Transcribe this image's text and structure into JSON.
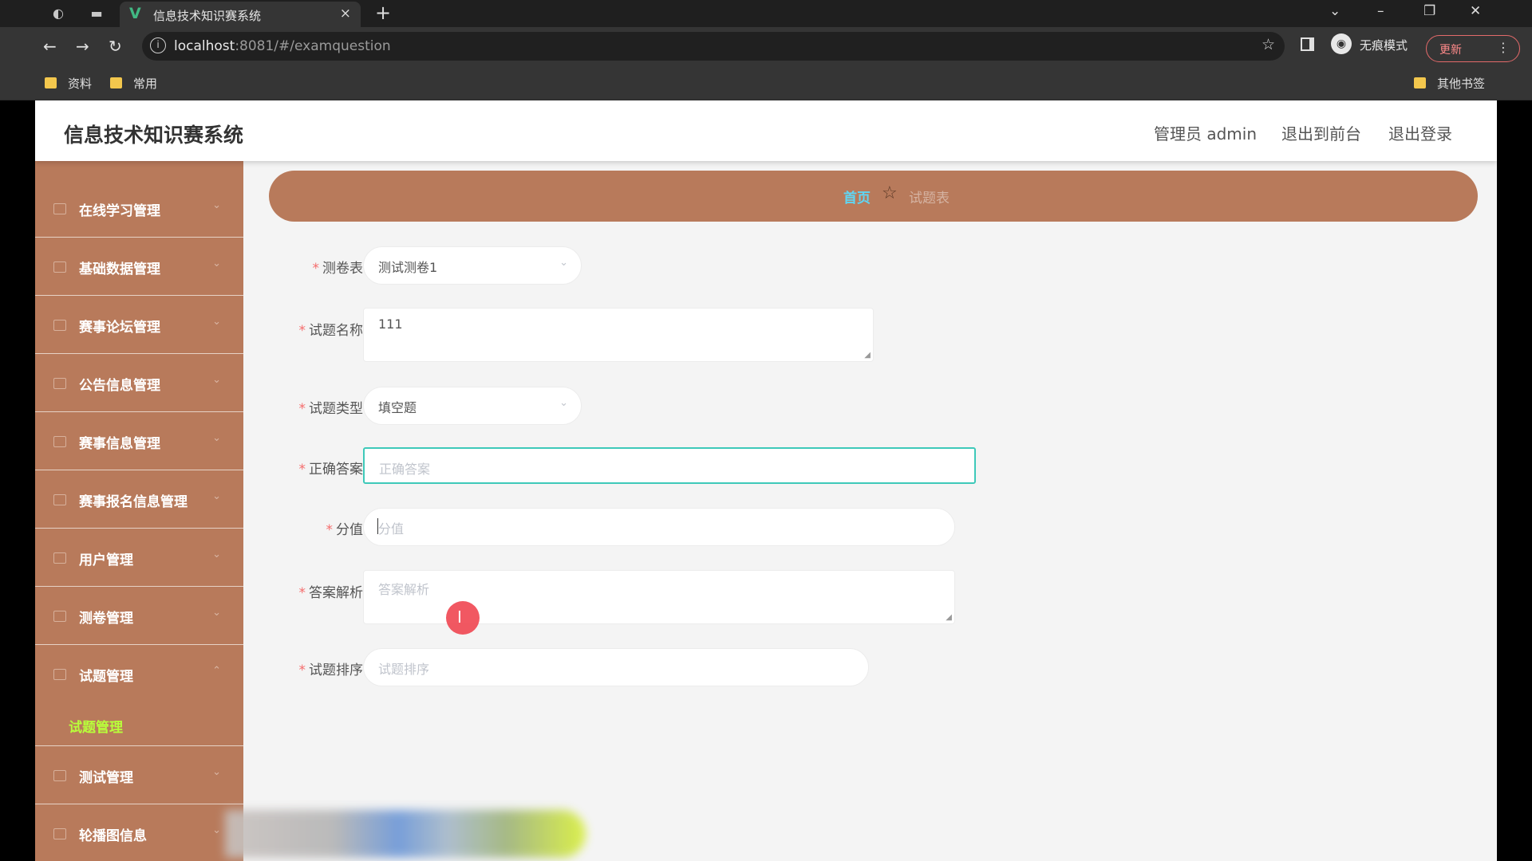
{
  "browser": {
    "tab_title": "信息技术知识赛系统",
    "tab_close": "×",
    "new_tab": "+",
    "url_host": "localhost",
    "url_path": ":8081/#/examquestion",
    "incognito_label": "无痕模式",
    "update_label": "更新",
    "bookmarks": [
      "资料",
      "常用"
    ],
    "other_bookmarks": "其他书签",
    "icons": {
      "minimize": "–",
      "restore": "❐",
      "close": "✕",
      "dropdown": "⌄",
      "back": "←",
      "forward": "→",
      "reload": "↻",
      "star": "☆",
      "info": "i",
      "more": "⋮"
    }
  },
  "app": {
    "title": "信息技术知识赛系统",
    "header": {
      "admin_label": "管理员 admin",
      "to_front": "退出到前台",
      "logout": "退出登录"
    },
    "sidebar": {
      "items": [
        {
          "label": "在线学习管理"
        },
        {
          "label": "基础数据管理"
        },
        {
          "label": "赛事论坛管理"
        },
        {
          "label": "公告信息管理"
        },
        {
          "label": "赛事信息管理"
        },
        {
          "label": "赛事报名信息管理"
        },
        {
          "label": "用户管理"
        },
        {
          "label": "测卷管理"
        },
        {
          "label": "试题管理"
        },
        {
          "label": "测试管理"
        },
        {
          "label": "轮播图信息"
        }
      ],
      "active_sub": "试题管理",
      "arrow": "⌄"
    },
    "breadcrumb": {
      "home": "首页",
      "separator_icon": "☆",
      "current": "试题表"
    },
    "form": {
      "exam_paper": {
        "label": "测卷表",
        "value": "测试测卷1"
      },
      "question_name": {
        "label": "试题名称",
        "value": "111"
      },
      "question_type": {
        "label": "试题类型",
        "value": "填空题"
      },
      "correct_answer": {
        "label": "正确答案",
        "placeholder": "正确答案"
      },
      "score": {
        "label": "分值",
        "placeholder": "分值"
      },
      "analysis": {
        "label": "答案解析",
        "placeholder": "答案解析"
      },
      "sort": {
        "label": "试题排序",
        "placeholder": "试题排序"
      },
      "required_mark": "*",
      "select_caret": "⌄",
      "resize_mark": "◢"
    }
  },
  "colors": {
    "sidebar_bg": "#b87a5b",
    "accent_focus": "#3ec9b9",
    "breadcrumb_home": "#5fd6f4",
    "active_sub": "#b8ff3a",
    "required": "#f56c6c"
  }
}
